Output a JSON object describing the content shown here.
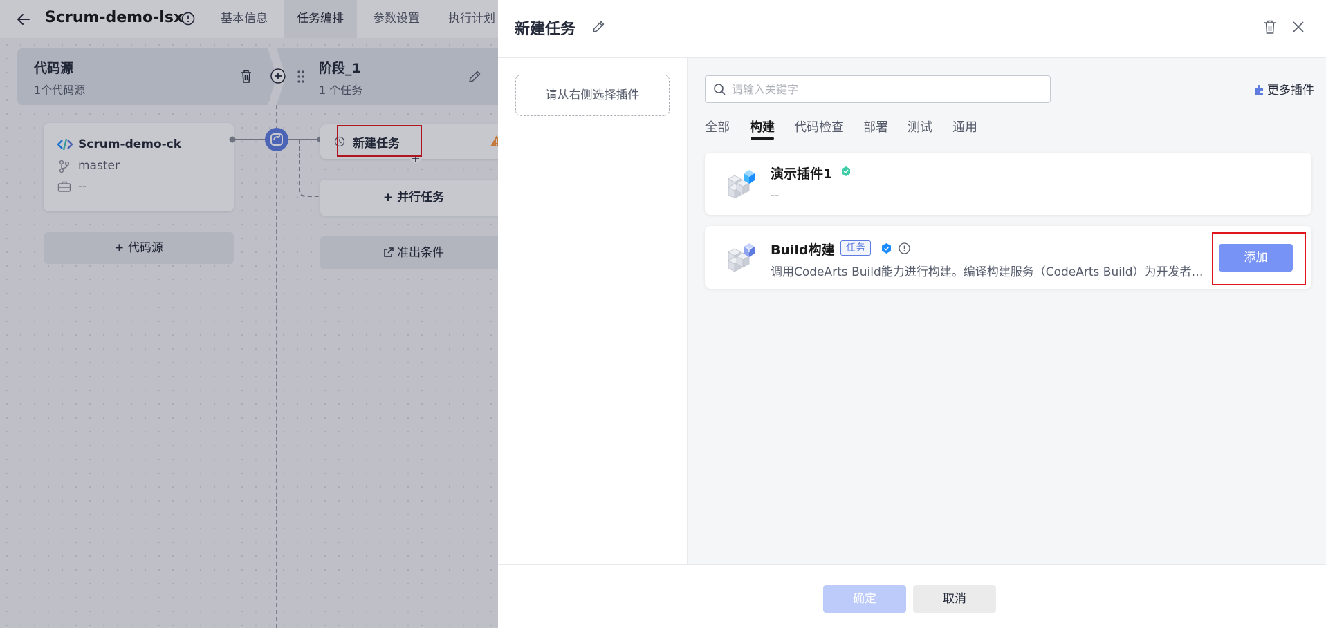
{
  "header": {
    "title": "Scrum-demo-lsx",
    "tabs": [
      {
        "label": "基本信息",
        "active": false
      },
      {
        "label": "任务编排",
        "active": true
      },
      {
        "label": "参数设置",
        "active": false
      },
      {
        "label": "执行计划",
        "active": false
      }
    ]
  },
  "pipeline": {
    "source_column": {
      "title": "代码源",
      "subtitle": "1个代码源",
      "repo_name": "Scrum-demo-ck",
      "branch": "master",
      "extra": "--",
      "add_source_label": "+ 代码源"
    },
    "stage_column": {
      "title": "阶段_1",
      "subtitle": "1 个任务",
      "task_name": "新建任务",
      "parallel_task_label": "+ 并行任务",
      "exit_condition_label": "准出条件"
    }
  },
  "drawer": {
    "title": "新建任务",
    "left_placeholder": "请从右侧选择插件",
    "search": {
      "placeholder": "请输入关键字",
      "value": ""
    },
    "more_plugins_label": "更多插件",
    "categories": [
      {
        "label": "全部",
        "active": false
      },
      {
        "label": "构建",
        "active": true
      },
      {
        "label": "代码检查",
        "active": false
      },
      {
        "label": "部署",
        "active": false
      },
      {
        "label": "测试",
        "active": false
      },
      {
        "label": "通用",
        "active": false
      }
    ],
    "plugins": [
      {
        "name": "演示插件1",
        "description": "--"
      },
      {
        "name": "Build构建",
        "tag": "任务",
        "description": "调用CodeArts Build能力进行构建。编译构建服务（CodeArts Build）为开发者提供配置简单的混合语言构建平台",
        "add_label": "添加"
      }
    ],
    "footer": {
      "confirm_label": "确定",
      "cancel_label": "取消"
    }
  },
  "colors": {
    "brand": "#5e7ce0",
    "add_button": "#7693f5",
    "confirm_disabled": "#bccbfa",
    "highlight_red": "#e0141b",
    "warning": "#fa9841"
  }
}
